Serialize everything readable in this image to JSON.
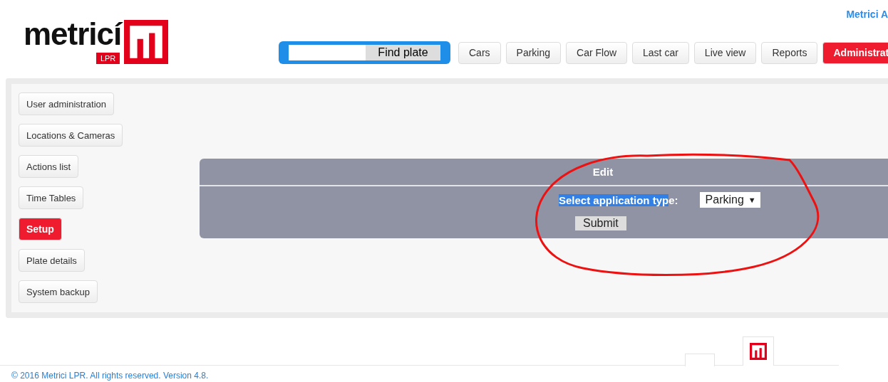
{
  "header": {
    "logo": {
      "word": "metricí",
      "tag": "LPR"
    },
    "user_link": "Metrici A",
    "search": {
      "button": "Find plate"
    },
    "nav": [
      {
        "label": "Cars",
        "selected": false
      },
      {
        "label": "Parking",
        "selected": false
      },
      {
        "label": "Car Flow",
        "selected": false
      },
      {
        "label": "Last car",
        "selected": false
      },
      {
        "label": "Live view",
        "selected": false
      },
      {
        "label": "Reports",
        "selected": false
      },
      {
        "label": "Administrat",
        "selected": true
      }
    ]
  },
  "sidebar": {
    "items": [
      {
        "label": "User administration",
        "selected": false
      },
      {
        "label": "Locations & Cameras",
        "selected": false
      },
      {
        "label": "Actions list",
        "selected": false
      },
      {
        "label": "Time Tables",
        "selected": false
      },
      {
        "label": "Setup",
        "selected": true
      },
      {
        "label": "Plate details",
        "selected": false
      },
      {
        "label": "System backup",
        "selected": false
      }
    ]
  },
  "edit_panel": {
    "title": "Edit",
    "label_parts": [
      {
        "text": "Select application typ",
        "highlighted": true
      },
      {
        "text": "e:",
        "highlighted": false
      }
    ],
    "select_value": "Parking",
    "select_arrow": "▼",
    "submit": "Submit"
  },
  "footer": {
    "copyright": "© 2016 Metrici LPR. All rights reserved. Version 4.8."
  }
}
